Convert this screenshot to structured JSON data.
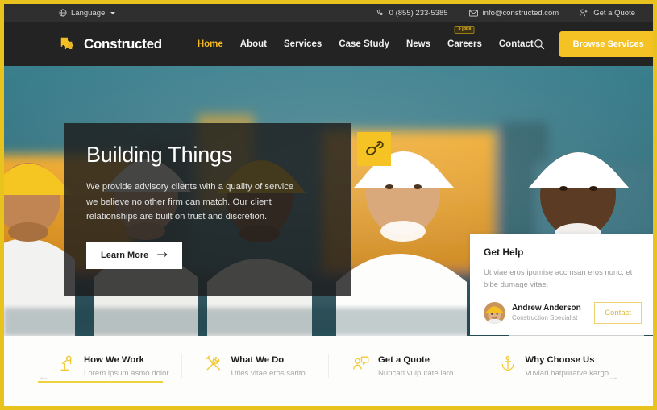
{
  "theme": {
    "accent": "#f5c226",
    "frame_border": "#e8c21d",
    "topbar_bg": "#2f2f2f",
    "nav_bg": "#232323",
    "hero_overlay": "rgba(28,28,28,0.82)"
  },
  "topbar": {
    "language_label": "Language",
    "language_icon": "globe-icon",
    "phone": "0 (855) 233-5385",
    "phone_icon": "phone-icon",
    "email": "info@constructed.com",
    "email_icon": "envelope-icon",
    "quote_label": "Get a Quote",
    "quote_icon": "user-plus-icon"
  },
  "nav": {
    "brand": "Constructed",
    "brand_icon": "puzzle-logo-icon",
    "items": [
      {
        "label": "Home",
        "active": true
      },
      {
        "label": "About",
        "active": false
      },
      {
        "label": "Services",
        "active": false
      },
      {
        "label": "Case Study",
        "active": false
      },
      {
        "label": "News",
        "active": false
      },
      {
        "label": "Careers",
        "active": false,
        "badge": "3 jobs"
      },
      {
        "label": "Contact",
        "active": false
      }
    ],
    "search_icon": "search-icon",
    "cta_label": "Browse Services"
  },
  "hero": {
    "title": "Building Things",
    "description": "We provide advisory clients with a quality of service we believe no other firm can match. Our client relationships are built on trust and discretion.",
    "button_label": "Learn More",
    "button_icon": "arrow-right-icon",
    "badge_icon": "wrench-icon"
  },
  "help_card": {
    "title": "Get Help",
    "description": "Ut viae eros ipumise accmsan eros nunc, et bibe dumage vitae.",
    "person_name": "Andrew Anderson",
    "person_role": "Construction Specialist",
    "avatar_icon": "worker-avatar",
    "contact_label": "Contact"
  },
  "features": {
    "items": [
      {
        "title": "How We Work",
        "subtitle": "Lorem ipsum asmo dolor",
        "icon": "crane-icon"
      },
      {
        "title": "What We Do",
        "subtitle": "Uties vitae eros sarito",
        "icon": "tools-icon"
      },
      {
        "title": "Get a Quote",
        "subtitle": "Nuncari vulputate laro",
        "icon": "quote-chat-icon"
      },
      {
        "title": "Why Choose Us",
        "subtitle": "Vuvlari batpuratve kargo",
        "icon": "anchor-icon"
      }
    ],
    "prev_icon": "arrow-left-icon",
    "prev_label": "←",
    "next_icon": "arrow-right-icon",
    "next_label": "→"
  }
}
